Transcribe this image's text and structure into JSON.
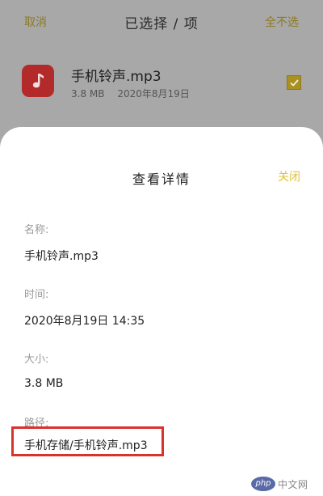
{
  "topbar": {
    "cancel_label": "取消",
    "title": "已选择 / 项",
    "select_none_label": "全不选"
  },
  "file": {
    "name": "手机铃声.mp3",
    "size": "3.8 MB",
    "date": "2020年8月19日",
    "icon": "music-note-icon",
    "checked": true
  },
  "sheet": {
    "title": "查看详情",
    "close_label": "关闭",
    "fields": {
      "name_label": "名称:",
      "name_value": "手机铃声.mp3",
      "time_label": "时间:",
      "time_value": "2020年8月19日 14:35",
      "size_label": "大小:",
      "size_value": "3.8 MB",
      "path_label": "路径:",
      "path_value": "手机存储/手机铃声.mp3"
    }
  },
  "watermark": {
    "logo_text": "php",
    "text": "中文网"
  },
  "colors": {
    "accent": "#e0c23a",
    "highlight_border": "#d9342b",
    "file_icon_bg": "#b32a2a"
  }
}
